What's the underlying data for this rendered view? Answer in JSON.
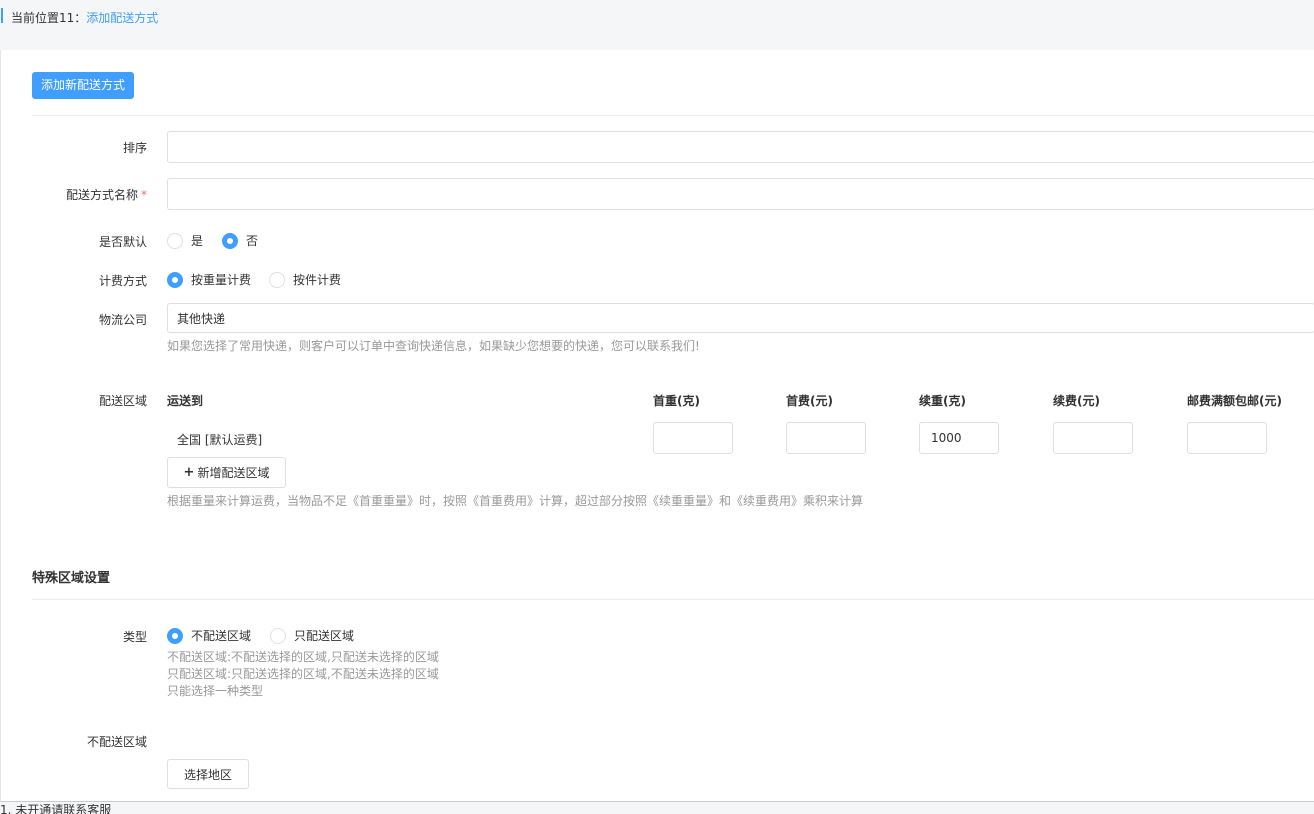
{
  "breadcrumb": {
    "prefix": "当前位置11：",
    "current": "添加配送方式"
  },
  "toolbar": {
    "add_button": "添加新配送方式"
  },
  "form": {
    "sort": {
      "label": "排序",
      "value": ""
    },
    "name": {
      "label": "配送方式名称",
      "required_mark": "*",
      "value": ""
    },
    "is_default": {
      "label": "是否默认",
      "options": [
        "是",
        "否"
      ],
      "selected": "否"
    },
    "billing": {
      "label": "计费方式",
      "options": [
        "按重量计费",
        "按件计费"
      ],
      "selected": "按重量计费"
    },
    "logistics": {
      "label": "物流公司",
      "value": "其他快递",
      "hint": "如果您选择了常用快递，则客户可以订单中查询快递信息，如果缺少您想要的快递，您可以联系我们!"
    },
    "region": {
      "label": "配送区域",
      "headers": [
        "运送到",
        "首重(克)",
        "首费(元)",
        "续重(克)",
        "续费(元)",
        "邮费满额包邮(元)"
      ],
      "row": {
        "area": "全国 [默认运费]",
        "first_weight": "",
        "first_fee": "",
        "extra_weight": "1000",
        "extra_fee": "",
        "free_threshold": ""
      },
      "add_button": "新增配送区域",
      "hint": "根据重量来计算运费，当物品不足《首重重量》时，按照《首重费用》计算，超过部分按照《续重重量》和《续重费用》乘积来计算"
    }
  },
  "special": {
    "title": "特殊区域设置",
    "type": {
      "label": "类型",
      "options": [
        "不配送区域",
        "只配送区域"
      ],
      "selected": "不配送区域"
    },
    "hints": [
      "不配送区域:不配送选择的区域,只配送未选择的区域",
      "只配送区域:只配送选择的区域,不配送未选择的区域",
      "只能选择一种类型"
    ],
    "no_delivery": {
      "label": "不配送区域",
      "button": "选择地区"
    }
  },
  "footer": {
    "text": "1. 未开通请联系客服"
  },
  "colors": {
    "primary": "#409eff",
    "required": "#f56c6c",
    "hint": "#999999",
    "border": "#dcdfe6"
  }
}
